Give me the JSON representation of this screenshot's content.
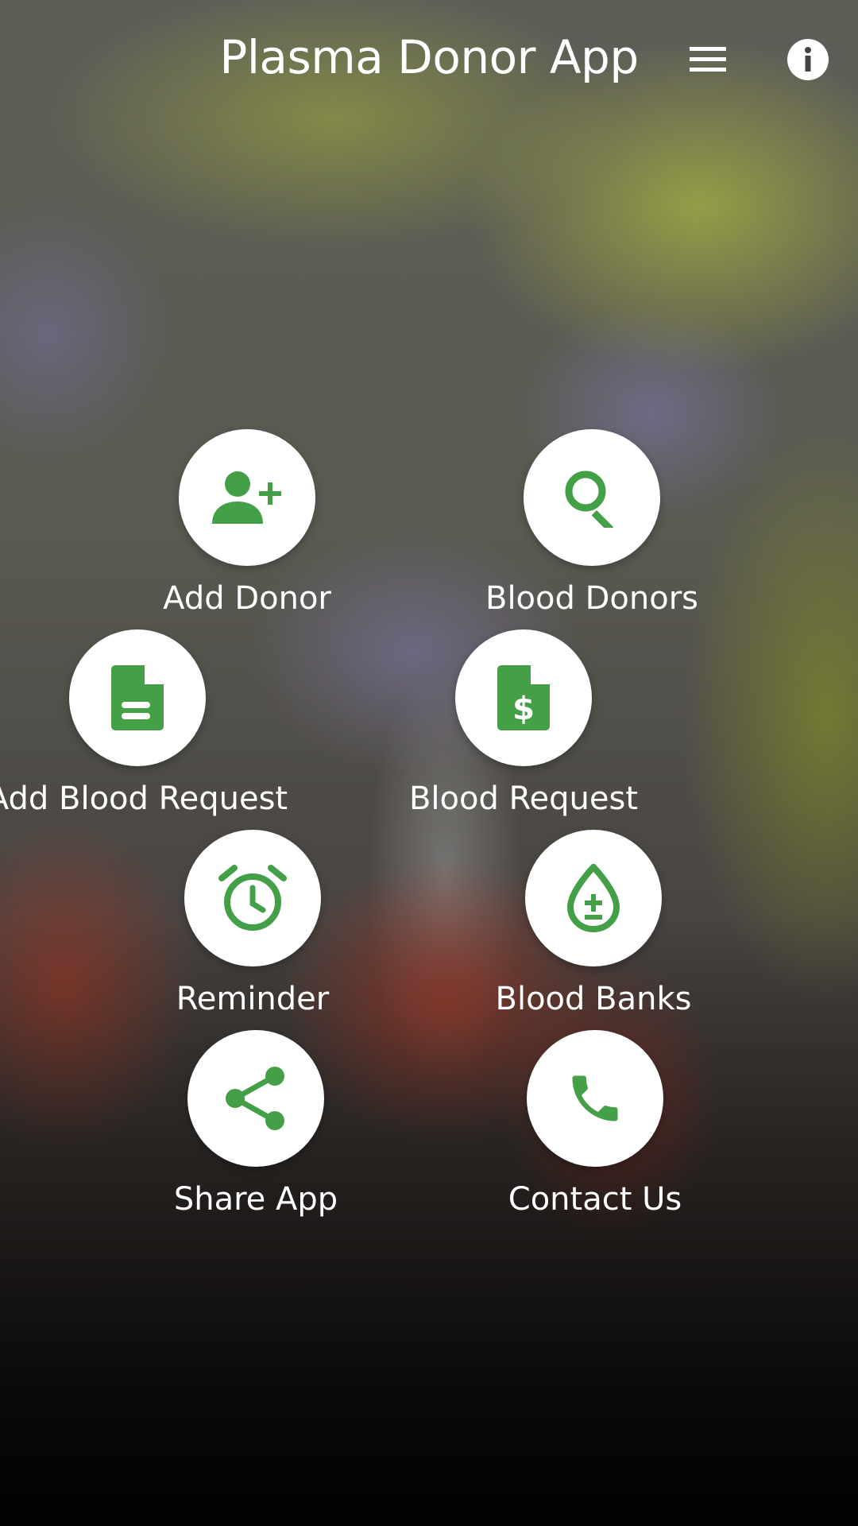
{
  "header": {
    "title": "Plasma Donor App",
    "menu_icon": "hamburger-menu-icon",
    "info_icon": "info-icon"
  },
  "colors": {
    "accent": "#43A047",
    "circle_bg": "#FFFFFF",
    "text": "#FFFFFF"
  },
  "menu": {
    "add_donor": {
      "label": "Add Donor",
      "icon": "add-person-icon"
    },
    "blood_donors": {
      "label": "Blood Donors",
      "icon": "search-icon"
    },
    "add_blood_request": {
      "label": "Add Blood Request",
      "icon": "document-icon"
    },
    "blood_request": {
      "label": "Blood Request",
      "icon": "dollar-document-icon"
    },
    "reminder": {
      "label": "Reminder",
      "icon": "alarm-clock-icon"
    },
    "blood_banks": {
      "label": "Blood Banks",
      "icon": "blood-drop-plus-minus-icon"
    },
    "share_app": {
      "label": "Share App",
      "icon": "share-icon"
    },
    "contact_us": {
      "label": "Contact Us",
      "icon": "phone-icon"
    }
  }
}
